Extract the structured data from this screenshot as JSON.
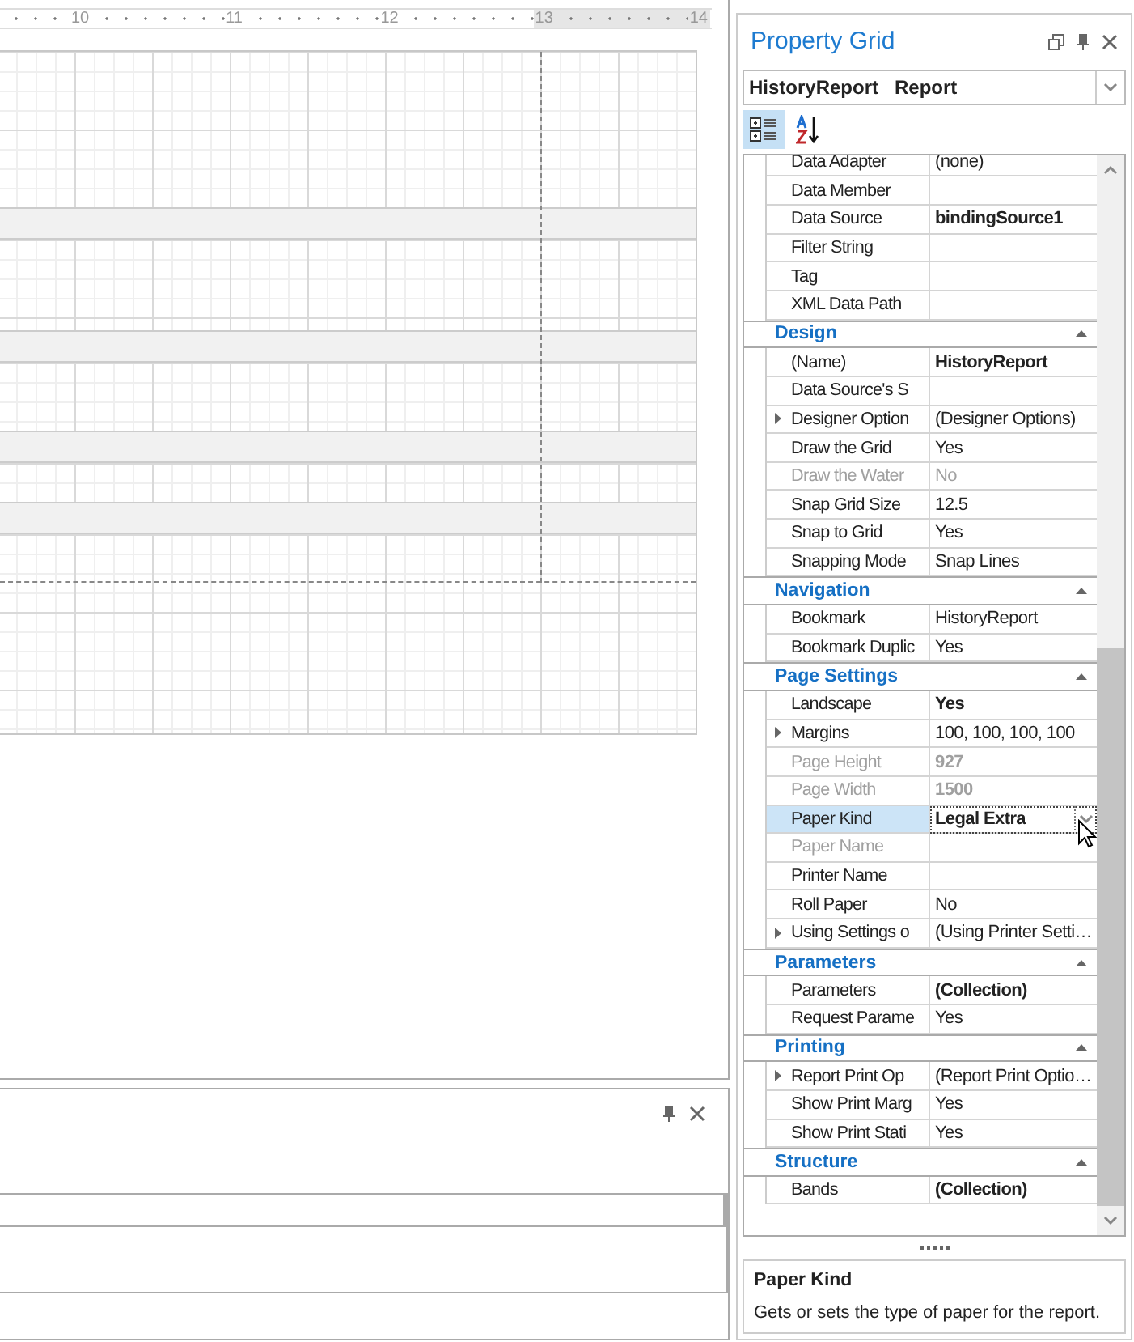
{
  "ruler": {
    "labels": [
      {
        "text": "10",
        "margin": false
      },
      {
        "text": "11",
        "margin": false
      },
      {
        "text": "12",
        "margin": false
      },
      {
        "text": "13",
        "margin": true
      },
      {
        "text": "14",
        "margin": true
      }
    ]
  },
  "property_grid": {
    "title": "Property Grid",
    "object_selector": {
      "name": "HistoryReport",
      "type": "Report"
    },
    "toolbar": [
      {
        "kind": "categorized",
        "selected": true
      },
      {
        "kind": "alphabetical",
        "selected": false
      }
    ],
    "sections": [
      {
        "rows": [
          {
            "name": "Data Adapter",
            "value": "(none)",
            "disabled": false,
            "expandable": false,
            "selected": false
          },
          {
            "name": "Data Member",
            "disabled": false,
            "expandable": false,
            "selected": false
          },
          {
            "name": "Data Source",
            "value": "bindingSource1",
            "bold": true,
            "disabled": false,
            "expandable": false,
            "selected": false
          },
          {
            "name": "Filter String",
            "disabled": false,
            "expandable": false,
            "selected": false
          },
          {
            "name": "Tag",
            "disabled": false,
            "expandable": false,
            "selected": false
          },
          {
            "name": "XML Data Path",
            "disabled": false,
            "expandable": false,
            "selected": false
          }
        ]
      },
      {
        "title": "Design",
        "expanded": true,
        "rows": [
          {
            "name": "(Name)",
            "value": "HistoryReport",
            "bold": true,
            "disabled": false,
            "expandable": false,
            "selected": false
          },
          {
            "name": "Data Source's S",
            "disabled": false,
            "expandable": false,
            "selected": false
          },
          {
            "name": "Designer Option",
            "value": "(Designer Options)",
            "disabled": false,
            "expandable": true,
            "selected": false
          },
          {
            "name": "Draw the Grid",
            "value": "Yes",
            "disabled": false,
            "expandable": false,
            "selected": false
          },
          {
            "name": "Draw the Water",
            "value": "No",
            "disabled": true,
            "expandable": false,
            "selected": false
          },
          {
            "name": "Snap Grid Size",
            "value": "12.5",
            "disabled": false,
            "expandable": false,
            "selected": false
          },
          {
            "name": "Snap to Grid",
            "value": "Yes",
            "disabled": false,
            "expandable": false,
            "selected": false
          },
          {
            "name": "Snapping Mode",
            "value": "Snap Lines",
            "disabled": false,
            "expandable": false,
            "selected": false
          }
        ]
      },
      {
        "title": "Navigation",
        "expanded": true,
        "rows": [
          {
            "name": "Bookmark",
            "value": "HistoryReport",
            "disabled": false,
            "expandable": false,
            "selected": false
          },
          {
            "name": "Bookmark Duplic",
            "value": "Yes",
            "disabled": false,
            "expandable": false,
            "selected": false
          }
        ]
      },
      {
        "title": "Page Settings",
        "expanded": true,
        "rows": [
          {
            "name": "Landscape",
            "value": "Yes",
            "bold": true,
            "disabled": false,
            "expandable": false,
            "selected": false
          },
          {
            "name": "Margins",
            "value": "100, 100, 100, 100",
            "disabled": false,
            "expandable": true,
            "selected": false
          },
          {
            "name": "Page Height",
            "value": "927",
            "bold": true,
            "disabled": true,
            "expandable": false,
            "selected": false
          },
          {
            "name": "Page Width",
            "value": "1500",
            "bold": true,
            "disabled": true,
            "expandable": false,
            "selected": false
          },
          {
            "name": "Paper Kind",
            "value": "Legal Extra",
            "bold": true,
            "disabled": false,
            "expandable": false,
            "selected": true
          },
          {
            "name": "Paper Name",
            "disabled": true,
            "expandable": false,
            "selected": false
          },
          {
            "name": "Printer Name",
            "disabled": false,
            "expandable": false,
            "selected": false
          },
          {
            "name": "Roll Paper",
            "value": "No",
            "disabled": false,
            "expandable": false,
            "selected": false
          },
          {
            "name": "Using Settings o",
            "value": "(Using Printer Setti…",
            "disabled": false,
            "expandable": true,
            "selected": false
          }
        ]
      },
      {
        "title": "Parameters",
        "expanded": true,
        "rows": [
          {
            "name": "Parameters",
            "value": "(Collection)",
            "bold": true,
            "disabled": false,
            "expandable": false,
            "selected": false
          },
          {
            "name": "Request Parame",
            "value": "Yes",
            "disabled": false,
            "expandable": false,
            "selected": false
          }
        ]
      },
      {
        "title": "Printing",
        "expanded": true,
        "rows": [
          {
            "name": "Report Print Op",
            "value": "(Report Print Optio…",
            "disabled": false,
            "expandable": true,
            "selected": false
          },
          {
            "name": "Show Print Marg",
            "value": "Yes",
            "disabled": false,
            "expandable": false,
            "selected": false
          },
          {
            "name": "Show Print Stati",
            "value": "Yes",
            "disabled": false,
            "expandable": false,
            "selected": false
          }
        ]
      },
      {
        "title": "Structure",
        "expanded": true,
        "rows": [
          {
            "name": "Bands",
            "value": "(Collection)",
            "bold": true,
            "disabled": false,
            "expandable": false,
            "selected": false
          }
        ]
      }
    ],
    "description": {
      "title": "Paper Kind",
      "text": "Gets or sets the type of paper for the report."
    }
  }
}
